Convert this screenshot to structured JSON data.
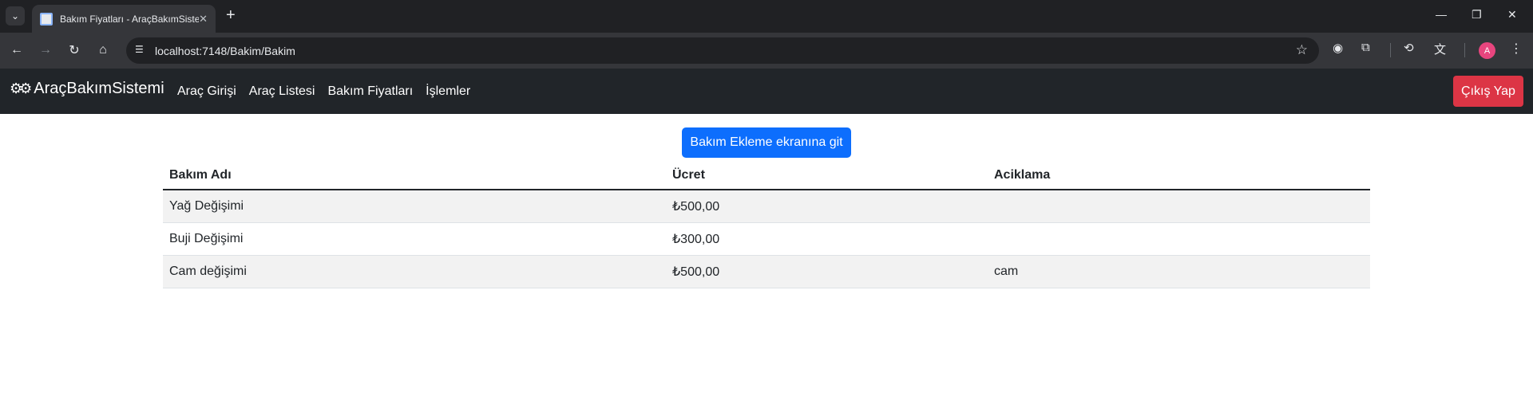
{
  "browser": {
    "tab_title": "Bakım Fiyatları - AraçBakımSistemi",
    "url": "localhost:7148/Bakim/Bakim",
    "profile_initial": "A"
  },
  "navbar": {
    "brand": "AraçBakımSistemi",
    "links": [
      "Araç Girişi",
      "Araç Listesi",
      "Bakım Fiyatları",
      "İşlemler"
    ],
    "logout": "Çıkış Yap"
  },
  "main": {
    "add_button": "Bakım Ekleme ekranına git",
    "table": {
      "headers": [
        "Bakım Adı",
        "Ücret",
        "Aciklama"
      ],
      "rows": [
        [
          "Yağ Değişimi",
          "₺500,00",
          ""
        ],
        [
          "Buji Değişimi",
          "₺300,00",
          ""
        ],
        [
          "Cam değişimi",
          "₺500,00",
          "cam"
        ]
      ]
    }
  },
  "colors": {
    "navbar_bg": "#212529",
    "primary": "#0d6efd",
    "danger": "#dc3545"
  }
}
